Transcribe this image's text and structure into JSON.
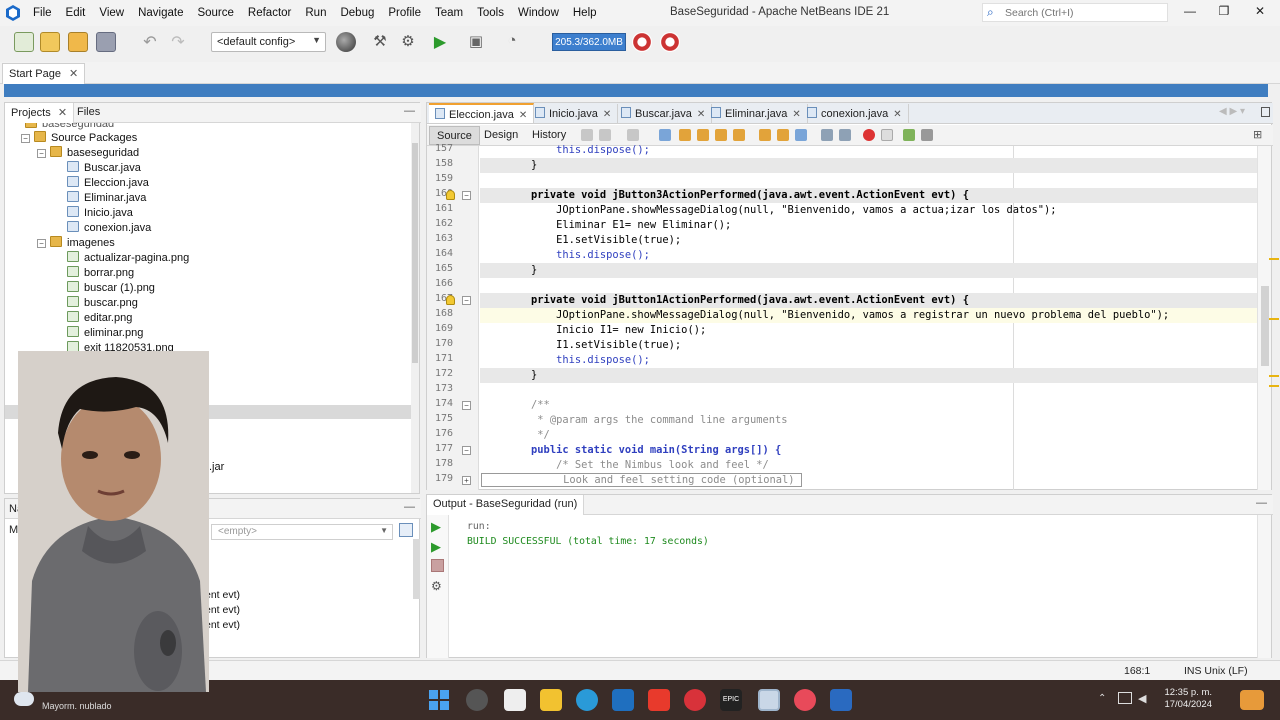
{
  "window": {
    "title": "BaseSeguridad - Apache NetBeans IDE 21",
    "menu": [
      "File",
      "Edit",
      "View",
      "Navigate",
      "Source",
      "Refactor",
      "Run",
      "Debug",
      "Profile",
      "Team",
      "Tools",
      "Window",
      "Help"
    ],
    "search_placeholder": "Search (Ctrl+I)",
    "controls": [
      "—",
      "❐",
      "✕"
    ]
  },
  "toolbar": {
    "config": "<default config>",
    "memory": "205.3/362.0MB"
  },
  "start_tab": {
    "label": "Start Page"
  },
  "projects": {
    "tabs": [
      "Projects",
      "Files"
    ],
    "tree": [
      {
        "label": "baseseguridad",
        "type": "project"
      },
      {
        "label": "Source Packages",
        "type": "folder"
      },
      {
        "label": "baseseguridad",
        "type": "package"
      },
      {
        "label": "Buscar.java",
        "type": "java"
      },
      {
        "label": "Eleccion.java",
        "type": "java"
      },
      {
        "label": "Eliminar.java",
        "type": "java"
      },
      {
        "label": "Inicio.java",
        "type": "java"
      },
      {
        "label": "conexion.java",
        "type": "java"
      },
      {
        "label": "imagenes",
        "type": "package"
      },
      {
        "label": "actualizar-pagina.png",
        "type": "img"
      },
      {
        "label": "borrar.png",
        "type": "img"
      },
      {
        "label": "buscar (1).png",
        "type": "img"
      },
      {
        "label": "buscar.png",
        "type": "img"
      },
      {
        "label": "editar.png",
        "type": "img"
      },
      {
        "label": "eliminar.png",
        "type": "img"
      },
      {
        "label": "exit 11820531.png",
        "type": "img"
      }
    ],
    "jar_fragment": ".jar"
  },
  "navigator": {
    "tab_fragment": "Na",
    "label_fragment": "M",
    "select": "<empty>",
    "items": [
      "ent evt)",
      "ent evt)",
      "ent evt)"
    ]
  },
  "editor": {
    "tabs": [
      "Eleccion.java",
      "Inicio.java",
      "Buscar.java",
      "Eliminar.java",
      "conexion.java"
    ],
    "modes": [
      "Source",
      "Design",
      "History"
    ],
    "lines": [
      {
        "n": "157",
        "code": "            this.dispose();"
      },
      {
        "n": "158",
        "code": "        }"
      },
      {
        "n": "159",
        "code": ""
      },
      {
        "n": "160",
        "code": "        private void jButton3ActionPerformed(java.awt.event.ActionEvent evt) {"
      },
      {
        "n": "161",
        "code": "            JOptionPane.showMessageDialog(null, \"Bienvenido, vamos a actua;izar los datos\");"
      },
      {
        "n": "162",
        "code": "            Eliminar E1= new Eliminar();"
      },
      {
        "n": "163",
        "code": "            E1.setVisible(true);"
      },
      {
        "n": "164",
        "code": "            this.dispose();"
      },
      {
        "n": "165",
        "code": "        }"
      },
      {
        "n": "166",
        "code": ""
      },
      {
        "n": "167",
        "code": "        private void jButton1ActionPerformed(java.awt.event.ActionEvent evt) {"
      },
      {
        "n": "168",
        "code": "            JOptionPane.showMessageDialog(null, \"Bienvenido, vamos a registrar un nuevo problema del pueblo\");"
      },
      {
        "n": "169",
        "code": "            Inicio I1= new Inicio();"
      },
      {
        "n": "170",
        "code": "            I1.setVisible(true);"
      },
      {
        "n": "171",
        "code": "            this.dispose();"
      },
      {
        "n": "172",
        "code": "        }"
      },
      {
        "n": "173",
        "code": ""
      },
      {
        "n": "174",
        "code": "        /**"
      },
      {
        "n": "175",
        "code": "         * @param args the command line arguments"
      },
      {
        "n": "176",
        "code": "         */"
      },
      {
        "n": "177",
        "code": "        public static void main(String args[]) {"
      },
      {
        "n": "178",
        "code": "            /* Set the Nimbus look and feel */"
      },
      {
        "n": "179",
        "code": "            Look and feel setting code (optional)"
      }
    ]
  },
  "output": {
    "tab": "Output - BaseSeguridad (run)",
    "lines": [
      "run:",
      "BUILD SUCCESSFUL (total time: 17 seconds)"
    ],
    "success_color": "#1e8a1e"
  },
  "status": {
    "position": "168:1",
    "mode": "INS Unix (LF)"
  },
  "taskbar": {
    "weather": "Mayorm. nublado",
    "time": "12:35 p. m.",
    "date": "17/04/2024"
  },
  "colors": {
    "accent": "#3f7dc0",
    "tab_active": "#f0a030",
    "taskbar": "#3a2c28"
  }
}
